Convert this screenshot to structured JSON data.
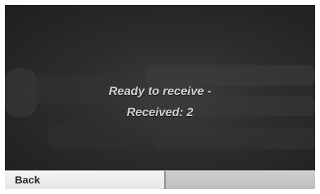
{
  "status": {
    "line1": "Ready to receive -",
    "line2": "Received: 2"
  },
  "softkeys": {
    "back_label": "Back",
    "right_label": ""
  }
}
